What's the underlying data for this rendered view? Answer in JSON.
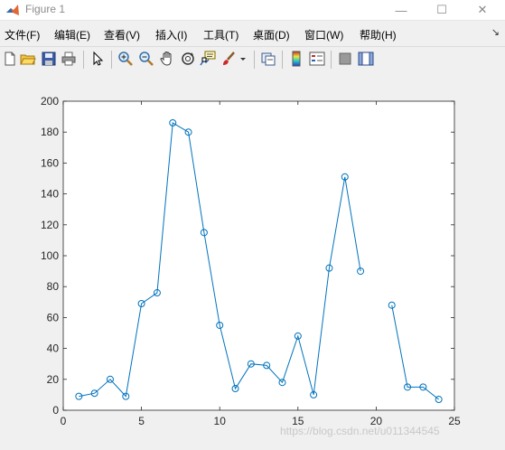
{
  "window": {
    "title": "Figure 1",
    "minimize_label": "—",
    "maximize_label": "☐",
    "close_label": "✕"
  },
  "menu": {
    "items": [
      "文件(F)",
      "编辑(E)",
      "查看(V)",
      "插入(I)",
      "工具(T)",
      "桌面(D)",
      "窗口(W)",
      "帮助(H)"
    ],
    "dock_arrow": "↘"
  },
  "toolbar": {
    "icons": [
      "new-figure-icon",
      "open-icon",
      "save-icon",
      "print-icon",
      "pointer-icon",
      "zoom-in-icon",
      "zoom-out-icon",
      "pan-icon",
      "rotate-icon",
      "data-cursor-icon",
      "brush-icon",
      "brush-dropdown-icon",
      "link-plot-icon",
      "colorbar-icon",
      "legend-icon",
      "hide-plot-tools-icon",
      "show-plot-tools-icon"
    ]
  },
  "watermark": "https://blog.csdn.net/u011344545",
  "colors": {
    "line": "#0072bd",
    "axes_bg": "#ffffff",
    "figure_bg": "#f0f0f0"
  },
  "chart_data": {
    "type": "line",
    "marker": "circle",
    "xlim": [
      0,
      25
    ],
    "ylim": [
      0,
      200
    ],
    "xticks": [
      0,
      5,
      10,
      15,
      20,
      25
    ],
    "yticks": [
      0,
      20,
      40,
      60,
      80,
      100,
      120,
      140,
      160,
      180,
      200
    ],
    "x": [
      1,
      2,
      3,
      4,
      5,
      6,
      7,
      8,
      9,
      10,
      11,
      12,
      13,
      14,
      15,
      16,
      17,
      18,
      19,
      20,
      21,
      22,
      23,
      24
    ],
    "values": [
      9,
      11,
      20,
      9,
      69,
      76,
      186,
      180,
      115,
      55,
      14,
      30,
      29,
      18,
      48,
      10,
      92,
      151,
      90,
      null,
      68,
      15,
      15,
      7
    ],
    "grid": false
  }
}
